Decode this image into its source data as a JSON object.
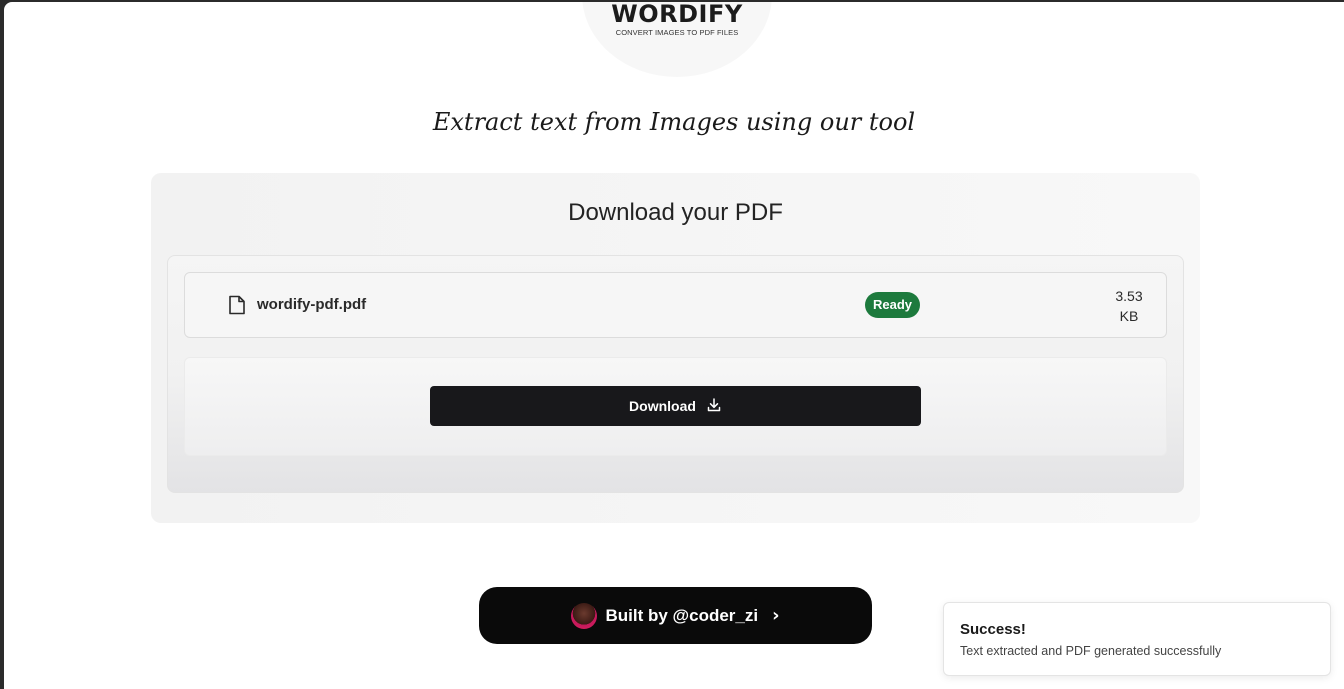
{
  "logo": {
    "title": "WORDIFY",
    "subtitle": "CONVERT IMAGES TO PDF FILES"
  },
  "tagline": "Extract text from Images using our tool",
  "card": {
    "title": "Download your PDF",
    "file": {
      "icon": "file-icon",
      "name": "wordify-pdf.pdf",
      "status": "Ready",
      "status_color": "#1d7a3d",
      "size_value": "3.53",
      "size_unit": "KB"
    },
    "download": {
      "label": "Download",
      "icon": "download-icon"
    }
  },
  "footer": {
    "built_by": "Built by @coder_zi",
    "chevron": "›"
  },
  "toast": {
    "title": "Success!",
    "message": "Text extracted and PDF generated successfully"
  }
}
